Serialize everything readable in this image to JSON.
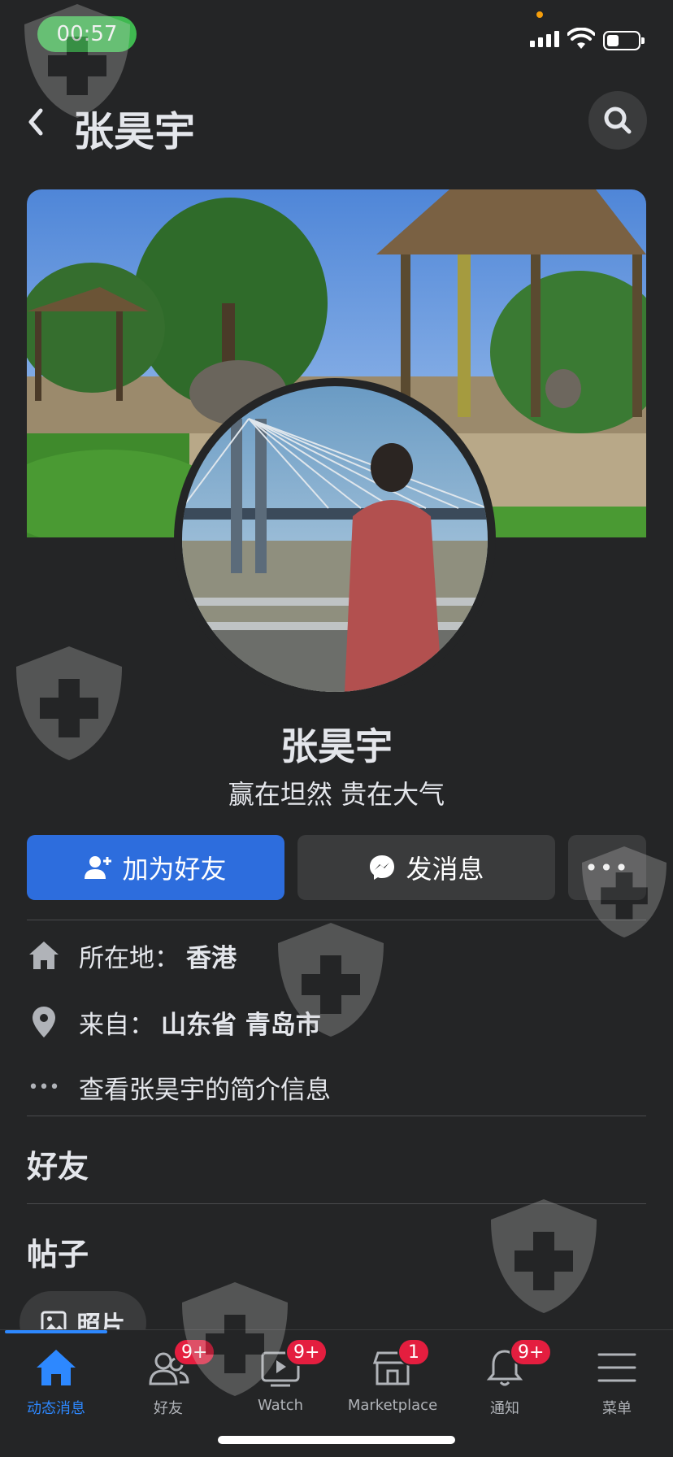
{
  "status_bar": {
    "time": "00:57"
  },
  "header": {
    "title": "张昊宇"
  },
  "profile": {
    "name": "张昊宇",
    "bio": "赢在坦然 贵在大气"
  },
  "actions": {
    "add_friend": "加为好友",
    "message": "发消息",
    "more": "•••"
  },
  "info": {
    "location_label": "所在地：",
    "location_value": "香港",
    "from_label": "来自：",
    "from_value": "山东省 青岛市",
    "about_link": "查看张昊宇的简介信息",
    "more_dots": "•••"
  },
  "sections": {
    "friends": "好友",
    "posts": "帖子",
    "photos": "照片"
  },
  "tabbar": {
    "items": [
      {
        "label": "动态消息",
        "icon": "home-icon",
        "badge": ""
      },
      {
        "label": "好友",
        "icon": "friends-icon",
        "badge": "9+"
      },
      {
        "label": "Watch",
        "icon": "watch-icon",
        "badge": "9+"
      },
      {
        "label": "Marketplace",
        "icon": "marketplace-icon",
        "badge": "1"
      },
      {
        "label": "通知",
        "icon": "bell-icon",
        "badge": "9+"
      },
      {
        "label": "菜单",
        "icon": "menu-icon",
        "badge": ""
      }
    ]
  },
  "colors": {
    "background": "#242526",
    "primary": "#2d6ddd",
    "badge": "#e41e3f",
    "active_tab": "#2d88ff"
  }
}
